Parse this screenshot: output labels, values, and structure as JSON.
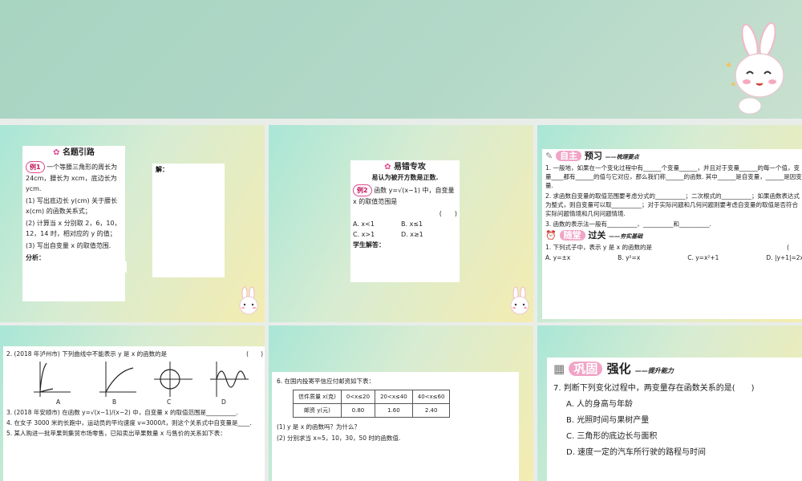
{
  "slide1": {
    "title": "名题引路",
    "example_badge": "例1",
    "example_text": "一个等腰三角形的周长为 24cm，腰长为 xcm，底边长为 ycm.",
    "q1": "(1) 写出底边长 y(cm) 关于腰长 x(cm) 的函数关系式；",
    "q2": "(2) 计算当 x 分别取 2，6，10，12，14 时，相对应的 y 的值；",
    "q3": "(3) 写出自变量 x 的取值范围.",
    "analysis": "分析：",
    "solution": "解："
  },
  "slide2": {
    "title": "易错专攻",
    "subtitle": "易认为被开方数是正数.",
    "example_badge": "例2",
    "example_text": "函数 y=√(x−1) 中，自变量 x 的取值范围是",
    "bracket": "(　　)",
    "optA": "A. x<1",
    "optB": "B. x≤1",
    "optC": "C. x>1",
    "optD": "D. x≥1",
    "student": "学生解答："
  },
  "slide3": {
    "badge1": "自主",
    "heading1": "预习",
    "sub1": "——梳理要点",
    "p1": "1. 一般地，如果在一个变化过程中有______个变量______，并且对于变量______的每一个值，变量____都有______的值与它对应，那么我们称______的函数. 其中______是自变量，______是因变量.",
    "p2": "2. 求函数自变量的取值范围要考虑分式的__________；二次根式的__________；如果函数表达式为整式，则自变量可以取__________；对于实际问题和几何问题则要考虑自变量的取值是否符合实际问题情境和几何问题情境.",
    "p3": "3. 函数的表示法一般有__________、__________和__________.",
    "badge2": "随堂",
    "heading2": "过关",
    "sub2": "——夯实基础",
    "q1": "1. 下列式子中，表示 y 是 x 的函数的是",
    "q1_bracket": "(　　)",
    "optA": "A. y=±x",
    "optB": "B. y²=x",
    "optC": "C. y=x²+1",
    "optD": "D. |y+1|=2x"
  },
  "slide4": {
    "q2": "2. (2018 年泸州市) 下列曲线中不能表示 y 是 x 的函数的是",
    "q2_bracket": "(　　)",
    "labels": [
      "A",
      "B",
      "C",
      "D"
    ],
    "q3": "3. (2018 年安顺市) 在函数 y=√(x−1)/(x−2) 中，自变量 x 的取值范围是__________.",
    "q4": "4. 在女子 3000 米的长跑中，运动员的平均速度 v=3000/t，则这个关系式中自变量是____.",
    "q5": "5. 某人购进一批苹果到集贸市场零售，已知卖出苹果数量 x 与售价的关系如下表："
  },
  "slide5": {
    "q6": "6. 在国内投寄平信应付邮资如下表：",
    "row1": [
      "信件质量 x(克)",
      "0<x≤20",
      "20<x≤40",
      "40<x≤60"
    ],
    "row2": [
      "邮资 y(元)",
      "0.80",
      "1.60",
      "2.40"
    ],
    "sub1": "(1) y 是 x 的函数吗？为什么？",
    "sub2": "(2) 分别求当 x=5，10，30，50 时的函数值."
  },
  "slide6": {
    "badge": "巩固",
    "heading": "强化",
    "sub": "——提升能力",
    "q7": "7. 判断下列变化过程中，两变量存在函数关系的是",
    "q7_bracket": "(　　)",
    "optA": "A. 人的身高与年龄",
    "optB": "B. 光照时间与果树产量",
    "optC": "C. 三角形的底边长与面积",
    "optD": "D. 速度一定的汽车所行驶的路程与时间"
  }
}
